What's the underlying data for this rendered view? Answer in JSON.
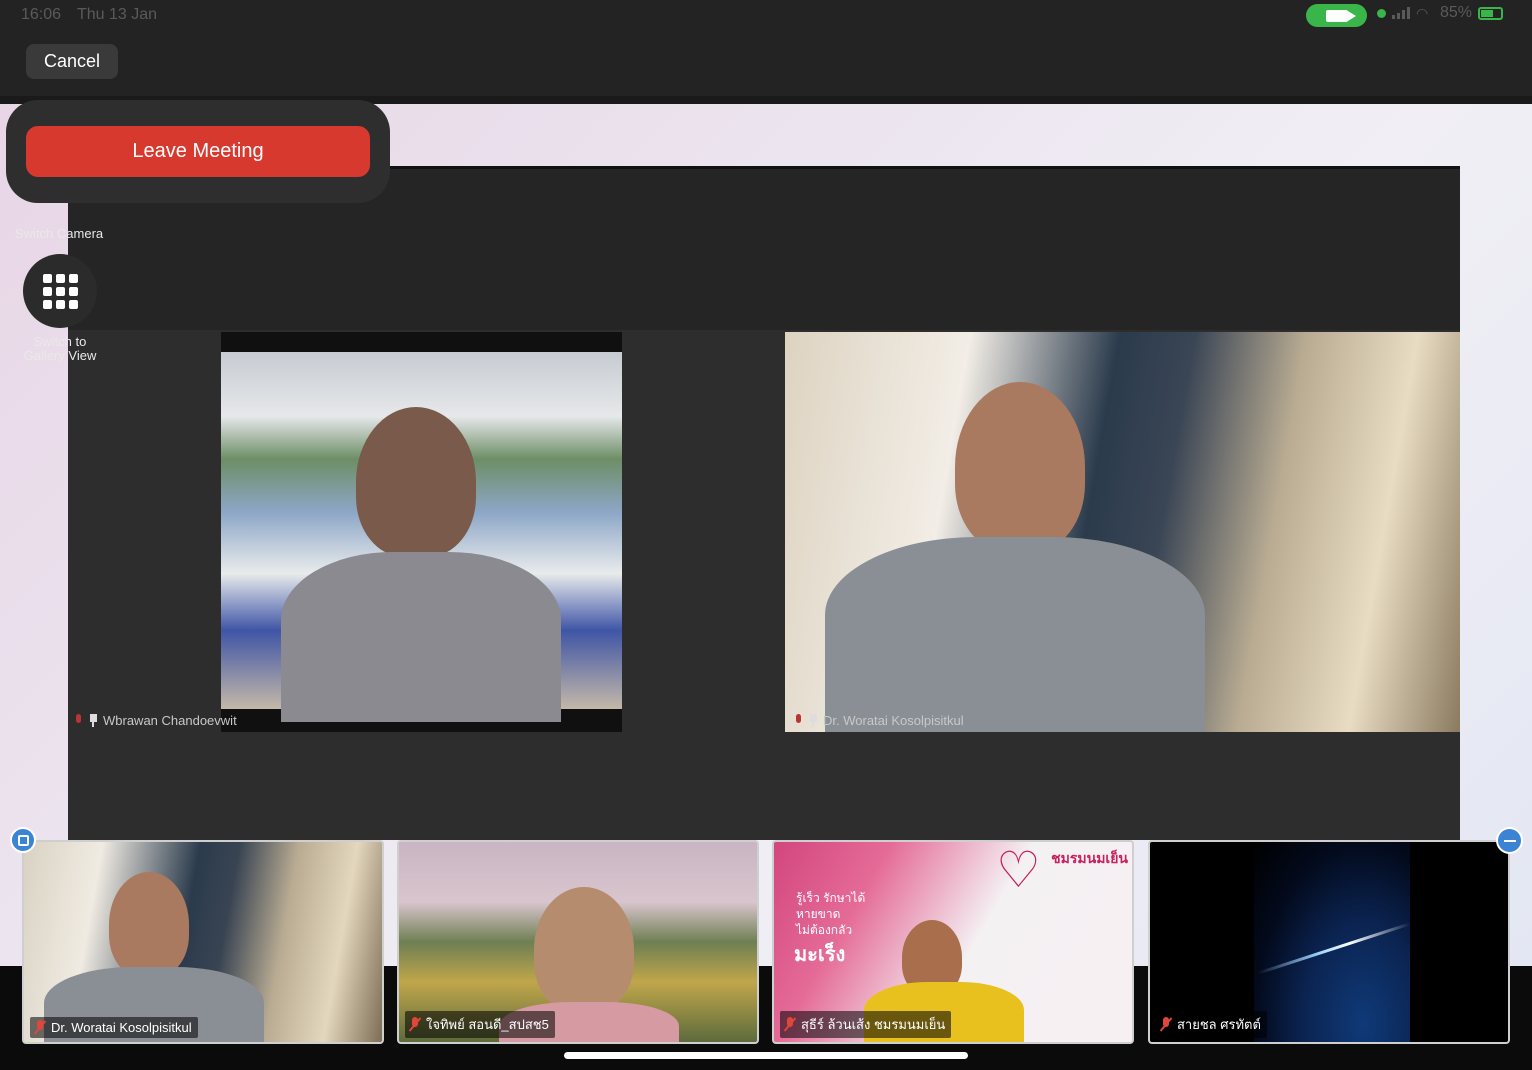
{
  "status_bar": {
    "time": "16:06",
    "date": "Thu 13 Jan",
    "battery": "85%",
    "camera_active_color": "#3ab54a"
  },
  "top_bar": {
    "cancel_label": "Cancel"
  },
  "controls": {
    "leave_meeting_label": "Leave Meeting",
    "switch_camera_label": "Switch Camera",
    "gallery_view_label_line1": "Switch to",
    "gallery_view_label_line2": "Gallery View"
  },
  "shared_screen": {
    "participants": [
      {
        "name": "Wbrawan Chandoevwit"
      },
      {
        "name": "Dr. Woratai Kosolpisitkul"
      }
    ]
  },
  "thumbnails": [
    {
      "name": "Dr. Woratai Kosolpisitkul",
      "muted": true
    },
    {
      "name": "ใจทิพย์ สอนดี_สปสช5",
      "muted": true
    },
    {
      "name": "สุธีร์ ล้วนเส้ง ชมรมนมเย็น",
      "muted": true,
      "poster_text_1": "รู้เร็ว รักษาได้",
      "poster_text_2": "หายขาด",
      "poster_text_3": "ไม่ต้องกลัว",
      "poster_title": "มะเร็ง",
      "poster_brand": "ชมรมนมเย็น"
    },
    {
      "name": "สายชล ศรทัตต์",
      "muted": true
    }
  ],
  "colors": {
    "leave_red": "#d8392e",
    "accent_blue": "#3b83d3"
  }
}
